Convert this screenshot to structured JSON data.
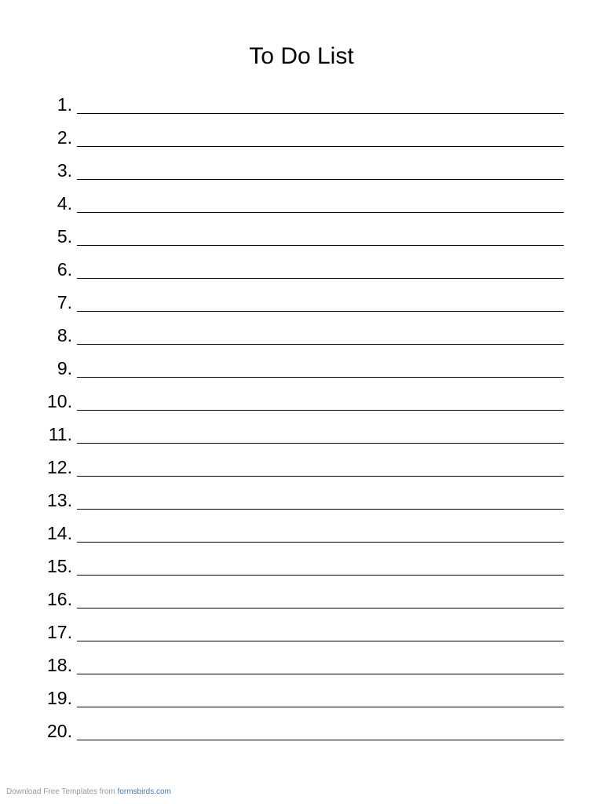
{
  "title": "To Do List",
  "items": [
    {
      "number": "1."
    },
    {
      "number": "2."
    },
    {
      "number": "3."
    },
    {
      "number": "4."
    },
    {
      "number": "5."
    },
    {
      "number": "6."
    },
    {
      "number": "7."
    },
    {
      "number": "8."
    },
    {
      "number": "9."
    },
    {
      "number": "10."
    },
    {
      "number": "11."
    },
    {
      "number": "12."
    },
    {
      "number": "13."
    },
    {
      "number": "14."
    },
    {
      "number": "15."
    },
    {
      "number": "16."
    },
    {
      "number": "17."
    },
    {
      "number": "18."
    },
    {
      "number": "19."
    },
    {
      "number": "20."
    }
  ],
  "footer": {
    "text": "Download Free Templates from ",
    "link": "formsbirds.com"
  }
}
